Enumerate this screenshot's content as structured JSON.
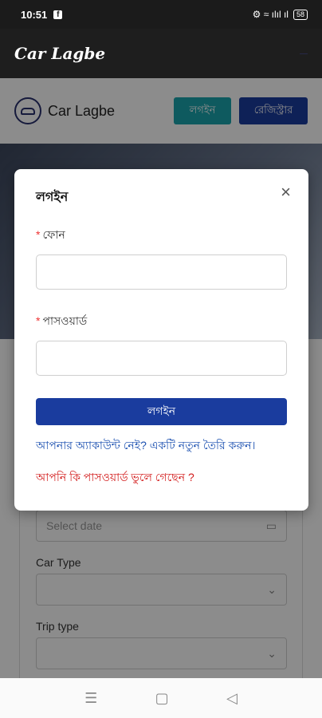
{
  "status_bar": {
    "time": "10:51",
    "fb": "f",
    "icons": "⚙ ≈ ılıl ıl",
    "battery": "58"
  },
  "app_bar": {
    "title": "Car Lagbe",
    "menu": "—"
  },
  "site_header": {
    "brand": "Car Lagbe",
    "login_btn": "লগইন",
    "register_btn": "রেজিস্ট্রার"
  },
  "background_form": {
    "date_placeholder": "Select date",
    "car_type_label": "Car Type",
    "trip_type_label": "Trip type"
  },
  "dialog": {
    "title": "লগইন",
    "close": "×",
    "required_mark": "*",
    "phone_label": "ফোন",
    "password_label": "পাসওয়ার্ড",
    "login_button": "লগইন",
    "register_link": "আপনার অ্যাকাউন্ট নেই? একটি নতুন তৈরি করুন।",
    "forgot_link": "আপনি কি পাসওয়ার্ড ভুলে গেছেন ?"
  },
  "nav_bar": {
    "menu": "☰",
    "home": "▢",
    "back": "◁"
  },
  "colors": {
    "primary": "#1a3c9e",
    "teal": "#1aa5ad",
    "link": "#1a4fb0",
    "danger": "#d21919"
  }
}
